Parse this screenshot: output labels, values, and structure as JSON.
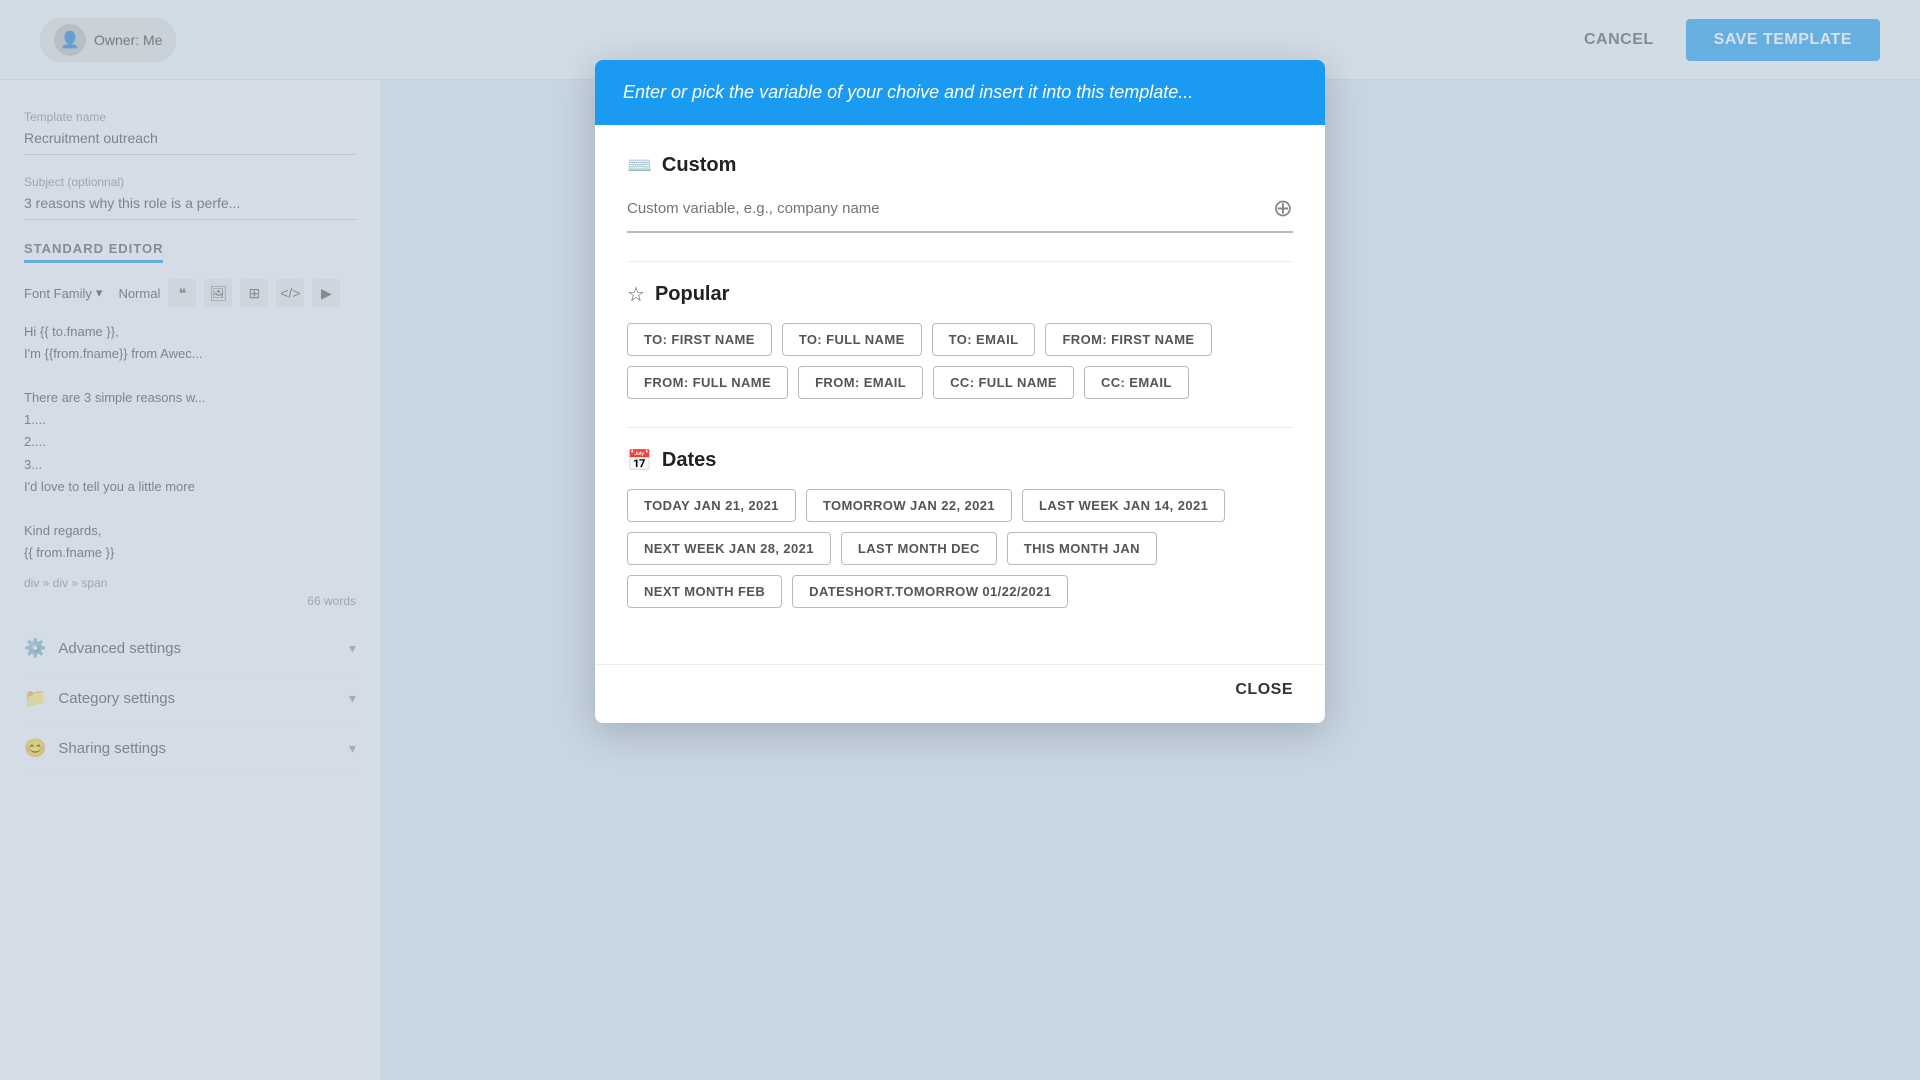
{
  "topbar": {
    "owner_label": "Owner: Me",
    "cancel_label": "CANCEL",
    "save_label": "SAVE TEMPLATE"
  },
  "left_panel": {
    "template_name_label": "Template name",
    "template_name_value": "Recruitment outreach",
    "subject_label": "Subject (optionnal)",
    "subject_value": "3 reasons why this role is a perfe...",
    "editor_label": "STANDARD EDITOR",
    "font_family_label": "Font Family",
    "font_size_label": "Normal",
    "editor_body": "Hi {{ to.fname }},\nI'm {{from.fname}} from Awec...\n\nThere are 3 simple reasons w...\n1....\n2....\n3...\nI'd love to tell you a little more",
    "editor_footer": "Kind regards,\n{{ from.fname }}",
    "breadcrumb": "div » div » span",
    "words_count": "66 words",
    "sidebar_items": [
      {
        "icon": "⚙️",
        "label": "Advanced settings"
      },
      {
        "icon": "📁",
        "label": "Category settings"
      },
      {
        "icon": "😊",
        "label": "Sharing settings"
      }
    ]
  },
  "modal": {
    "header_text": "Enter or pick the variable of your choive and insert it into this template...",
    "sections": {
      "custom": {
        "title": "Custom",
        "icon": "⌨️",
        "input_placeholder": "Custom variable, e.g., company name"
      },
      "popular": {
        "title": "Popular",
        "icon": "⭐",
        "tags": [
          "TO: FIRST NAME",
          "TO: FULL NAME",
          "TO: EMAIL",
          "FROM: FIRST NAME",
          "FROM: FULL NAME",
          "FROM: EMAIL",
          "CC: FULL NAME",
          "CC: EMAIL"
        ]
      },
      "dates": {
        "title": "Dates",
        "icon": "📅",
        "tags": [
          "TODAY JAN 21, 2021",
          "TOMORROW JAN 22, 2021",
          "LAST WEEK JAN 14, 2021",
          "NEXT WEEK JAN 28, 2021",
          "LAST MONTH DEC",
          "THIS MONTH JAN",
          "NEXT MONTH FEB",
          "DATESHORT.TOMORROW 01/22/2021"
        ]
      }
    },
    "close_label": "CLOSE"
  }
}
